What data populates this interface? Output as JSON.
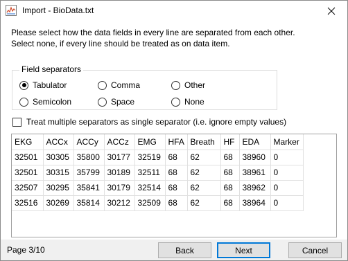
{
  "window": {
    "title": "Import - BioData.txt",
    "app_icon": "chart-icon",
    "close_icon": "close-icon"
  },
  "instructions": {
    "line1": "Please select how the data fields in every line are separated from each other.",
    "line2": "Select none, if every line should be treated as on data item."
  },
  "separators": {
    "group_title": "Field separators",
    "options": [
      {
        "label": "Tabulator",
        "checked": true
      },
      {
        "label": "Comma",
        "checked": false
      },
      {
        "label": "Other",
        "checked": false
      },
      {
        "label": "Semicolon",
        "checked": false
      },
      {
        "label": "Space",
        "checked": false
      },
      {
        "label": "None",
        "checked": false
      }
    ],
    "selected": "Tabulator"
  },
  "treat_multiple": {
    "label": "Treat multiple separators as single separator (i.e. ignore empty values)",
    "checked": false
  },
  "preview_table": {
    "headers": [
      "EKG",
      "ACCx",
      "ACCy",
      "ACCz",
      "EMG",
      "HFA",
      "Breath",
      "HF",
      "EDA",
      "Marker"
    ],
    "rows": [
      [
        "32501",
        "30305",
        "35800",
        "30177",
        "32519",
        "68",
        "62",
        "68",
        "38960",
        "0"
      ],
      [
        "32501",
        "30315",
        "35799",
        "30189",
        "32511",
        "68",
        "62",
        "68",
        "38961",
        "0"
      ],
      [
        "32507",
        "30295",
        "35841",
        "30179",
        "32514",
        "68",
        "62",
        "68",
        "38962",
        "0"
      ],
      [
        "32516",
        "30269",
        "35814",
        "30212",
        "32509",
        "68",
        "62",
        "68",
        "38964",
        "0"
      ]
    ]
  },
  "footer": {
    "page": "Page  3/10",
    "back_label": "Back",
    "next_label": "Next",
    "cancel_label": "Cancel"
  },
  "colors": {
    "accent": "#0078d7",
    "button_face": "#e1e1e1",
    "dialog_bg": "#f0f0f0"
  }
}
